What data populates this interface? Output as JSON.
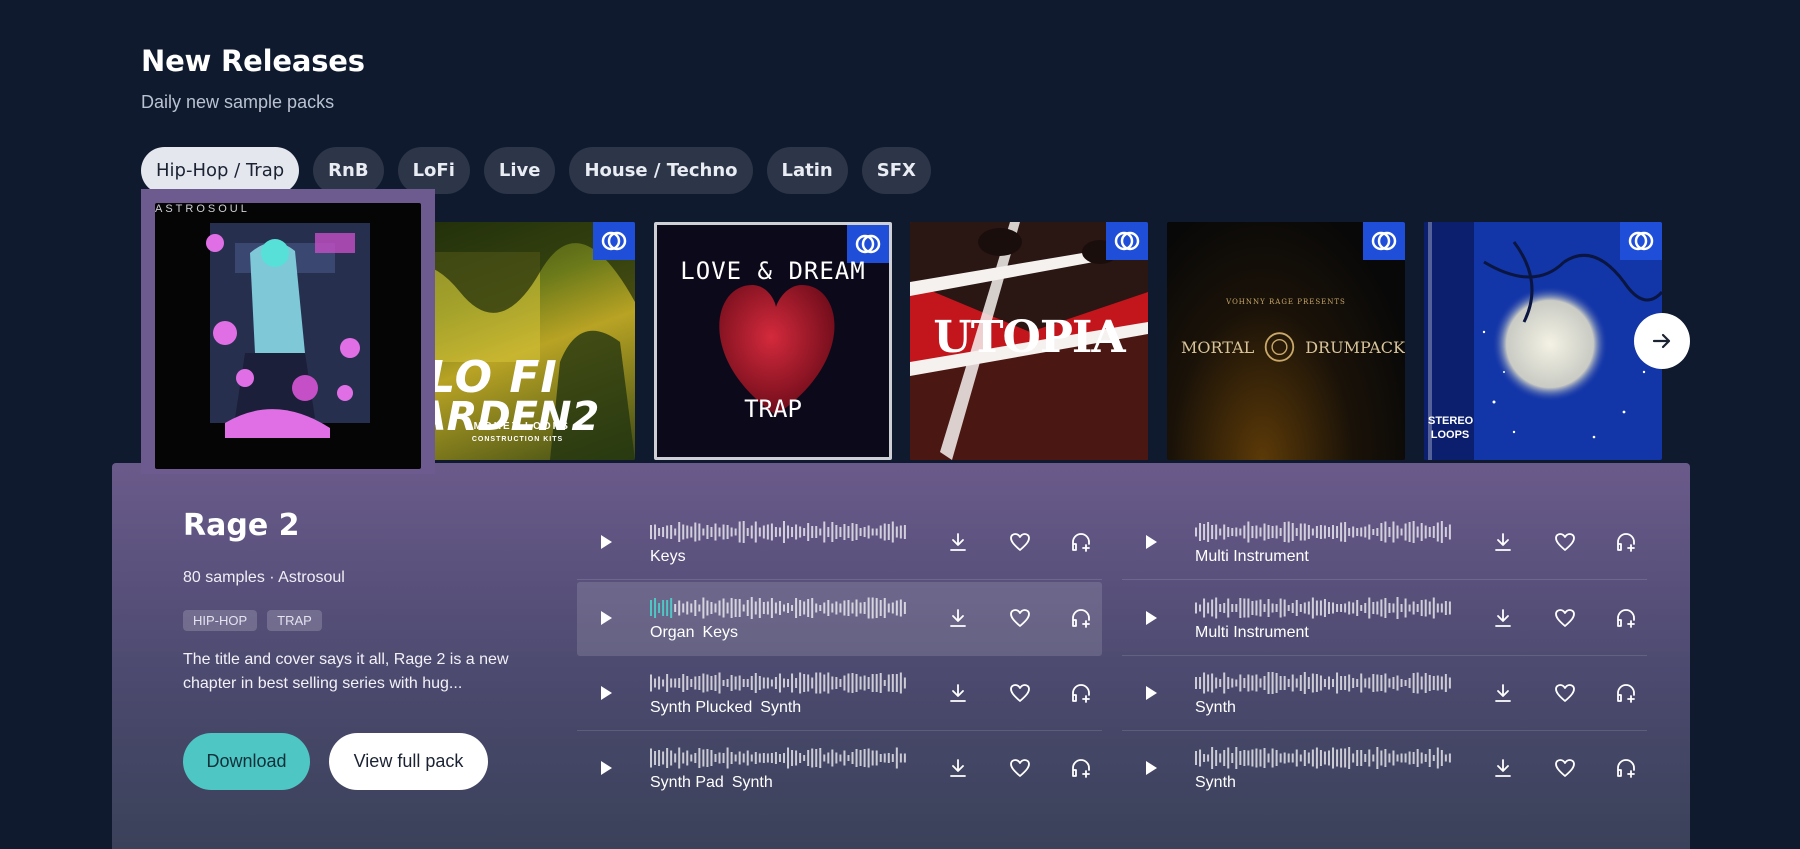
{
  "header": {
    "title": "New Releases",
    "subtitle": "Daily new sample packs"
  },
  "genres": [
    {
      "label": "Hip-Hop / Trap",
      "active": true
    },
    {
      "label": "RnB",
      "active": false
    },
    {
      "label": "LoFi",
      "active": false
    },
    {
      "label": "Live",
      "active": false
    },
    {
      "label": "House / Techno",
      "active": false
    },
    {
      "label": "Latin",
      "active": false
    },
    {
      "label": "SFX",
      "active": false
    }
  ],
  "covers": {
    "selected": {
      "brand": "ASTROSOUL"
    },
    "lofi": {
      "line1": "LO FI",
      "line2": "ARDEN2",
      "line3": "SMOKEY LOOPS",
      "line4": "CONSTRUCTION KITS"
    },
    "love": {
      "top": "LOVE & DREAM",
      "bottom": "TRAP"
    },
    "utopia": {
      "title": "UTOPIA"
    },
    "mortal": {
      "presents": "VOHNNY RAGE PRESENTS",
      "left": "MORTAL",
      "right": "DRUMPACK"
    },
    "stereo": {
      "side": "STEREO LOOPS"
    }
  },
  "pack": {
    "title": "Rage 2",
    "meta": "80 samples · Astrosoul",
    "tags": [
      "HIP-HOP",
      "TRAP"
    ],
    "description": "The title and cover says it all, Rage 2 is a new chapter in best selling series with hug...",
    "download_label": "Download",
    "view_label": "View full pack"
  },
  "samples_left": [
    {
      "name": "Keys",
      "tag": ""
    },
    {
      "name": "Organ",
      "tag": "Keys"
    },
    {
      "name": "Synth Plucked",
      "tag": "Synth"
    },
    {
      "name": "Synth Pad",
      "tag": "Synth"
    }
  ],
  "samples_right": [
    {
      "name": "Multi Instrument",
      "tag": ""
    },
    {
      "name": "Multi Instrument",
      "tag": ""
    },
    {
      "name": "Synth",
      "tag": ""
    },
    {
      "name": "Synth",
      "tag": ""
    }
  ],
  "playing_progress": 0.08,
  "icons": {
    "badge": "ring-logo-icon",
    "next": "arrow-right-icon",
    "play": "play-icon",
    "download": "download-icon",
    "like": "heart-icon",
    "add": "headphones-plus-icon"
  },
  "colors": {
    "background": "#0f1a2e",
    "accent": "#4ec6c4",
    "badge": "#1f4ed8",
    "panel": "#6a5a8b"
  }
}
